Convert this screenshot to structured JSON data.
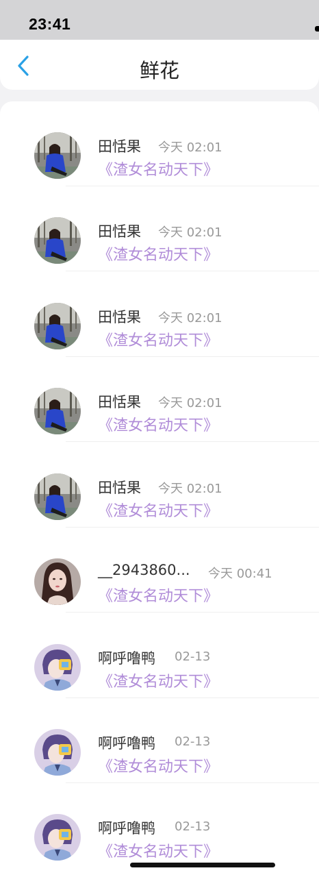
{
  "status_bar": {
    "time": "23:41"
  },
  "header": {
    "title": "鲜花",
    "back_icon": "chevron-left-icon",
    "accent": "#2aa1e6"
  },
  "colors": {
    "book_title": "#b08cd8",
    "timestamp": "#999999"
  },
  "records": [
    {
      "name": "田恬果",
      "time": "今天 02:01",
      "book": "《渣女名动天下》",
      "avatar": "woman-in-blue-photo"
    },
    {
      "name": "田恬果",
      "time": "今天 02:01",
      "book": "《渣女名动天下》",
      "avatar": "woman-in-blue-photo"
    },
    {
      "name": "田恬果",
      "time": "今天 02:01",
      "book": "《渣女名动天下》",
      "avatar": "woman-in-blue-photo"
    },
    {
      "name": "田恬果",
      "time": "今天 02:01",
      "book": "《渣女名动天下》",
      "avatar": "woman-in-blue-photo"
    },
    {
      "name": "田恬果",
      "time": "今天 02:01",
      "book": "《渣女名动天下》",
      "avatar": "woman-in-blue-photo"
    },
    {
      "name": "__2943860...",
      "time": "今天 00:41",
      "book": "《渣女名动天下》",
      "avatar": "portrait-photo"
    },
    {
      "name": "啊呼噜鸭",
      "time": "02-13",
      "book": "《渣女名动天下》",
      "avatar": "anime-illustration"
    },
    {
      "name": "啊呼噜鸭",
      "time": "02-13",
      "book": "《渣女名动天下》",
      "avatar": "anime-illustration"
    },
    {
      "name": "啊呼噜鸭",
      "time": "02-13",
      "book": "《渣女名动天下》",
      "avatar": "anime-illustration"
    }
  ]
}
